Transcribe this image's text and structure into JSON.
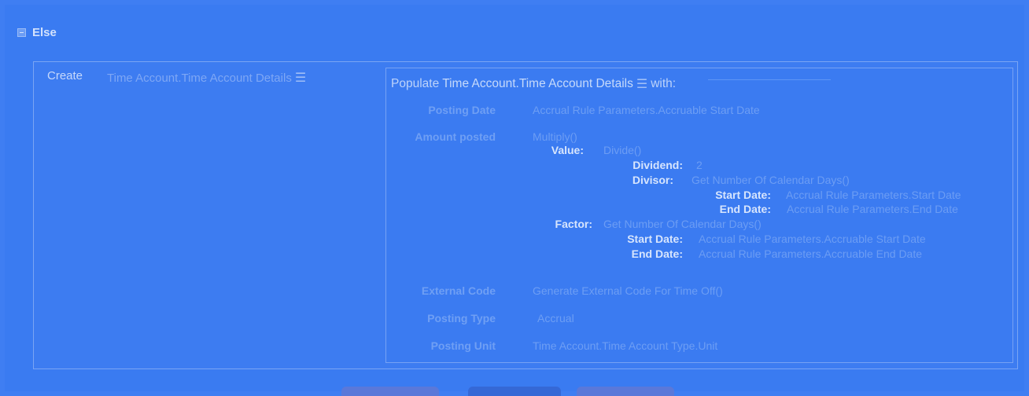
{
  "else_block": {
    "label": "Else"
  },
  "create": {
    "label": "Create",
    "target": "Time Account.Time Account Details",
    "menu_glyph": "☰"
  },
  "populate": {
    "prefix": "Populate",
    "target": "Time Account.Time Account Details",
    "menu_glyph": "☰",
    "suffix": "with:"
  },
  "fields": {
    "posting_date": {
      "label": "Posting Date",
      "value": "Accrual Rule Parameters.Accruable Start Date"
    },
    "amount_posted": {
      "label": "Amount posted",
      "function": "Multiply()",
      "value_kw": "Value:",
      "value_fn": "Divide()",
      "dividend_kw": "Dividend:",
      "dividend_val": "2",
      "divisor_kw": "Divisor:",
      "divisor_fn": "Get Number Of Calendar Days()",
      "divisor_start_kw": "Start Date:",
      "divisor_start_val": "Accrual Rule Parameters.Start Date",
      "divisor_end_kw": "End Date:",
      "divisor_end_val": "Accrual Rule Parameters.End Date",
      "factor_kw": "Factor:",
      "factor_fn": "Get Number Of Calendar Days()",
      "factor_start_kw": "Start Date:",
      "factor_start_val": "Accrual Rule Parameters.Accruable Start Date",
      "factor_end_kw": "End Date:",
      "factor_end_val": "Accrual Rule Parameters.Accruable End Date"
    },
    "external_code": {
      "label": "External Code",
      "value": "Generate External Code For Time Off()"
    },
    "posting_type": {
      "label": "Posting Type",
      "value": "Accrual"
    },
    "posting_unit": {
      "label": "Posting Unit",
      "value": "Time Account.Time Account Type.Unit"
    }
  },
  "colors": {
    "background": "#3f7ef2",
    "text_light": "#d7e5fd",
    "text_muted": "#6d9ef4"
  }
}
